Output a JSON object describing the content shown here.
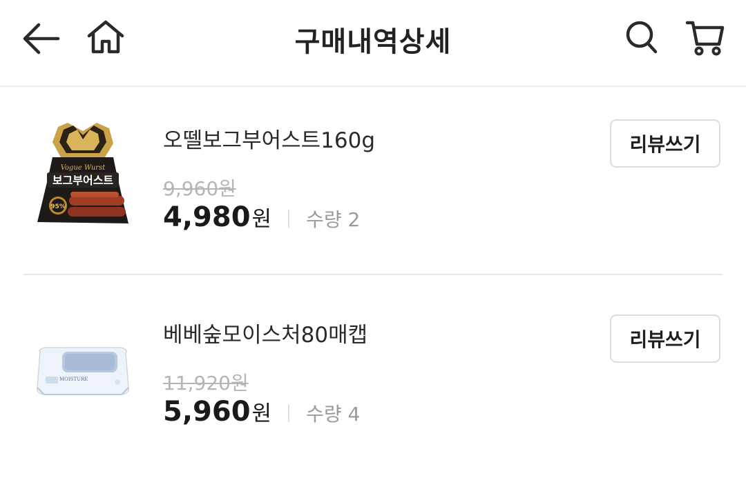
{
  "header": {
    "title": "구매내역상세",
    "back_icon": "arrow-left-icon",
    "home_icon": "home-icon",
    "search_icon": "search-icon",
    "cart_icon": "cart-icon"
  },
  "items": [
    {
      "name": "오뗄보그부어스트160g",
      "original_price": "9,960원",
      "price_value": "4,980",
      "price_unit": "원",
      "quantity": "수량 2",
      "review_label": "리뷰쓰기",
      "product_image": {
        "brand_text": "Vogue Wurst",
        "label_text": "보그부어스트",
        "badge_text": "95%"
      }
    },
    {
      "name": "베베숲모이스처80매캡",
      "original_price": "11,920원",
      "price_value": "5,960",
      "price_unit": "원",
      "quantity": "수량 4",
      "review_label": "리뷰쓰기",
      "product_image": {
        "label_text": "MOISTURE"
      }
    }
  ],
  "colors": {
    "text_primary": "#1a1a1a",
    "text_muted": "#9a9a9a",
    "strikethrough": "#b5b5b5",
    "border": "#dcdcdc"
  }
}
